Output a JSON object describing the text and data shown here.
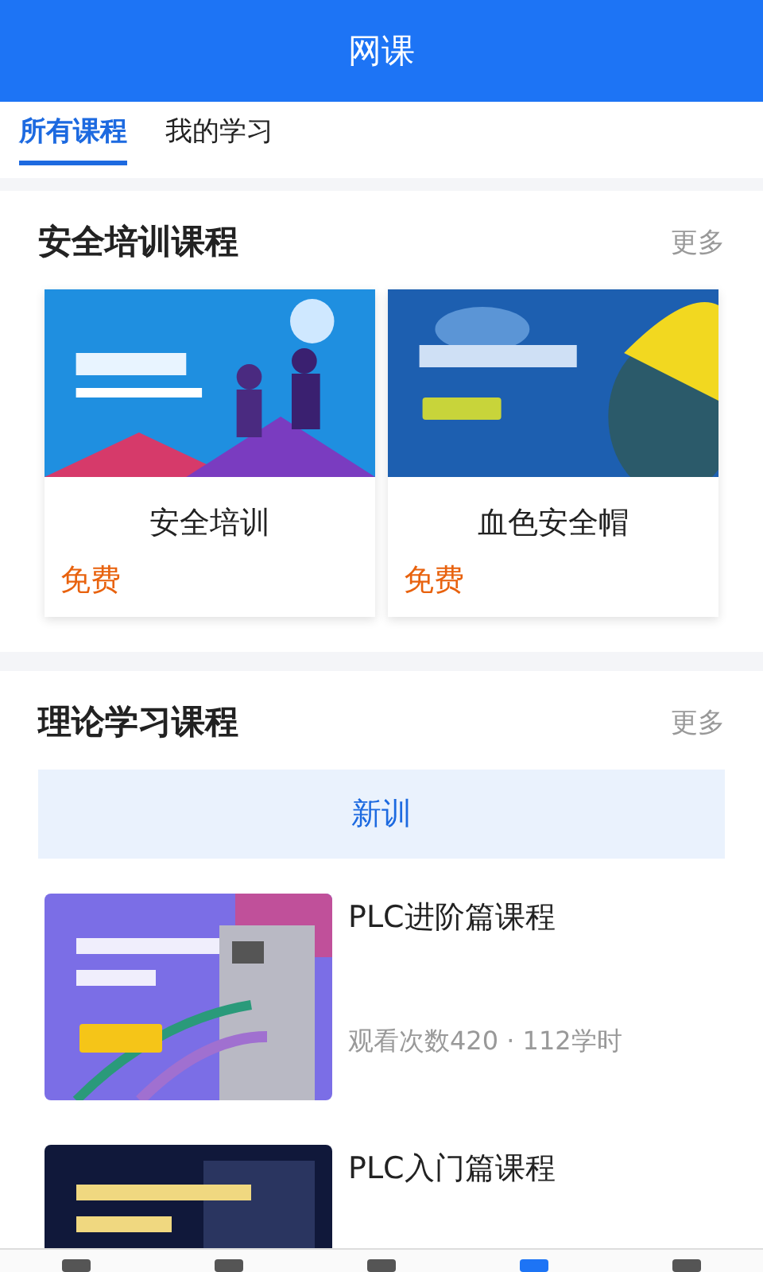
{
  "header": {
    "title": "网课"
  },
  "tabs": [
    {
      "label": "所有课程",
      "selected": true
    },
    {
      "label": "我的学习",
      "selected": false
    }
  ],
  "sections": [
    {
      "title": "安全培训课程",
      "more": "更多",
      "kind": "cards",
      "cards": [
        {
          "title": "安全培训",
          "price": "免费"
        },
        {
          "title": "血色安全帽",
          "price": "免费"
        }
      ]
    },
    {
      "title": "理论学习课程",
      "more": "更多",
      "kind": "list",
      "category": "新训",
      "courses": [
        {
          "title": "PLC进阶篇课程",
          "meta": "观看次数420 · 112学时"
        },
        {
          "title": "PLC入门篇课程"
        }
      ]
    }
  ],
  "bottom_nav": [
    {
      "selected": false
    },
    {
      "selected": false
    },
    {
      "selected": false
    },
    {
      "selected": true
    },
    {
      "selected": false
    }
  ]
}
